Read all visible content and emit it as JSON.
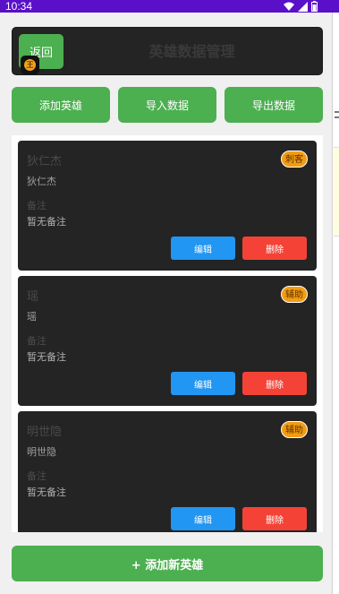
{
  "status_bar": {
    "time": "10:34",
    "icons": [
      "wifi-icon",
      "signal-icon",
      "battery-icon"
    ]
  },
  "header": {
    "back_label": "返回",
    "title": "英雄数据管理",
    "badge_glyph": "王"
  },
  "actions": {
    "add": "添加英雄",
    "import": "导入数据",
    "export": "导出数据"
  },
  "heroes": [
    {
      "name": "狄仁杰",
      "role": "刺客",
      "subtitle": "狄仁杰",
      "note_label": "备注",
      "note": "暂无备注",
      "edit": "编辑",
      "delete": "删除"
    },
    {
      "name": "瑶",
      "role": "辅助",
      "subtitle": "瑶",
      "note_label": "备注",
      "note": "暂无备注",
      "edit": "编辑",
      "delete": "删除"
    },
    {
      "name": "明世隐",
      "role": "辅助",
      "subtitle": "明世隐",
      "note_label": "备注",
      "note": "暂无备注",
      "edit": "编辑",
      "delete": "删除"
    }
  ],
  "add_new_label": "+ 添加新英雄",
  "colors": {
    "status_bar": "#5a0fc8",
    "primary_green": "#4caf50",
    "card_bg": "#242424",
    "edit_blue": "#2196f3",
    "delete_red": "#f44336",
    "role_orange": "#f39c12"
  }
}
